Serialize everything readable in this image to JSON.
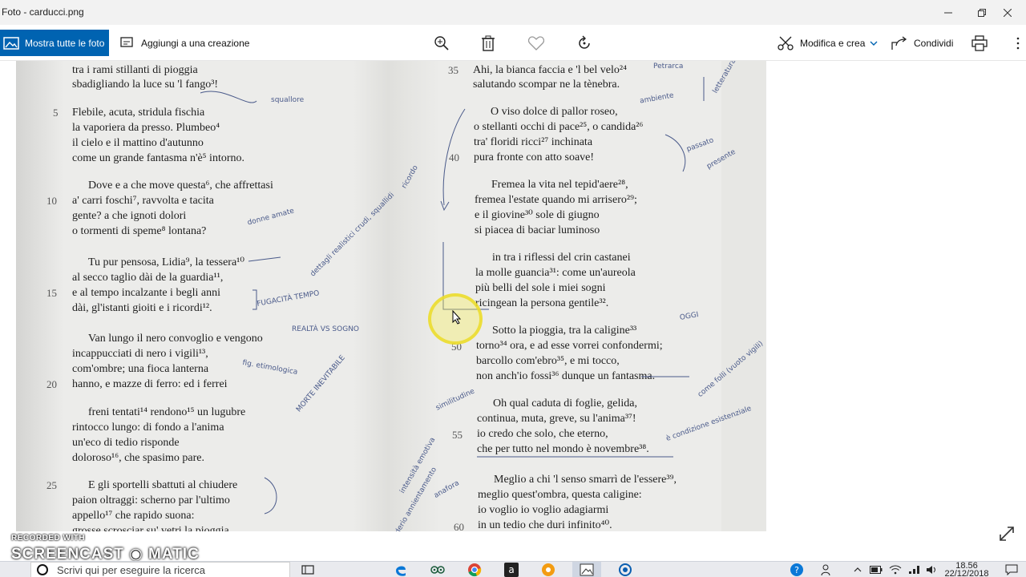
{
  "window": {
    "title": "Foto - carducci.png"
  },
  "toolbar": {
    "show_all_label": "Mostra tutte le foto",
    "add_to_creation_label": "Aggiungi a una creazione",
    "edit_create_label": "Modifica e crea",
    "share_label": "Condividi"
  },
  "page": {
    "left_lines": [
      "tra i rami stillanti di pioggia",
      "sbadigliando la luce su 'l fango³!",
      "Flebile, acuta, stridula fischia",
      "la vaporiera da presso. Plumbeo⁴",
      "il cielo e il mattino d'autunno",
      "come un grande fantasma n'è⁵ intorno.",
      "Dove e a che move questa⁶, che affrettasi",
      "a' carri foschi⁷, ravvolta e tacita",
      "gente? a che ignoti dolori",
      "o tormenti di speme⁸ lontana?",
      "Tu pur pensosa, Lidia⁹, la tessera¹⁰",
      "al secco taglio dài de la guardia¹¹,",
      "e al tempo incalzante i begli anni",
      "dài, gl'istanti gioiti e i ricordi¹².",
      "Van lungo il nero convoglio e vengono",
      "incappucciati di nero i vigili¹³,",
      "com'ombre; una fioca lanterna",
      "hanno, e mazze di ferro: ed i ferrei",
      "freni tentati¹⁴ rendono¹⁵ un lugubre",
      "rintocco lungo: di fondo a l'anima",
      "un'eco di tedio risponde",
      "doloroso¹⁶, che spasimo pare.",
      "E gli sportelli sbattuti al chiudere",
      "paion oltraggi: scherno par l'ultimo",
      "appello¹⁷ che rapido suona:",
      "grosse scrosciar su' vetri la pioggia."
    ],
    "right_lines": [
      "Ahi, la bianca faccia e 'l bel velo²⁴",
      "salutando scompar ne la tènebra.",
      "O viso dolce di pallor roseo,",
      "o stellanti occhi di pace²⁵, o candida²⁶",
      "tra' floridi ricci²⁷ inchinata",
      "pura fronte con atto soave!",
      "Fremea la vita nel tepid'aere²⁸,",
      "fremea l'estate quando mi arrisero²⁹;",
      "e il giovine³⁰ sole di giugno",
      "si piacea di baciar luminoso",
      "in tra i riflessi del crin castanei",
      "la molle guancia³¹: come un'aureola",
      "più belli del sole i miei sogni",
      "ricingean la persona gentile³².",
      "Sotto la pioggia, tra la caligine³³",
      "torno³⁴ ora, e ad esse vorrei confondermi;",
      "barcollo com'ebro³⁵, e mi tocco,",
      "non anch'io fossi³⁶ dunque un fantasma.",
      "Oh qual caduta di foglie, gelida,",
      "continua, muta, greve, su l'anima³⁷!",
      "io credo che solo, che eterno,",
      "che per tutto nel mondo è novembre³⁸.",
      "Meglio a chi 'l senso smarrì de l'essere³⁹,",
      "meglio quest'ombra, questa caligine:",
      "io voglio io voglio adagiarmi",
      "in un tedio che duri infinito⁴⁰."
    ],
    "left_numbers": [
      "5",
      "10",
      "15",
      "20",
      "25"
    ],
    "right_numbers": [
      "35",
      "40",
      "50",
      "55",
      "60"
    ],
    "notes": [
      "squallore",
      "Petrarca",
      "letteratura",
      "ambiente",
      "passato",
      "presente",
      "ricordo",
      "donne amate",
      "dettagli realistici crudi, squallidi",
      "FUGACITÀ TEMPO",
      "REALTÀ VS SOGNO",
      "MORTE INEVITABILE",
      "fig. etimologica",
      "OGGI",
      "come folli (vuoto vigili)",
      "è condizione esistenziale",
      "similitudine",
      "intensità emotiva",
      "desiderio annientamento",
      "anafora"
    ]
  },
  "watermark": {
    "line1": "RECORDED WITH",
    "line2": "SCREENCAST ◉ MATIC"
  },
  "taskbar": {
    "search_placeholder": "Scrivi qui per eseguire la ricerca",
    "time": "18.56",
    "date": "22/12/2018"
  },
  "colors": {
    "accent": "#0063b1",
    "cursor_highlight": "#f0e030",
    "annotation_ink": "#4a5a8a"
  }
}
